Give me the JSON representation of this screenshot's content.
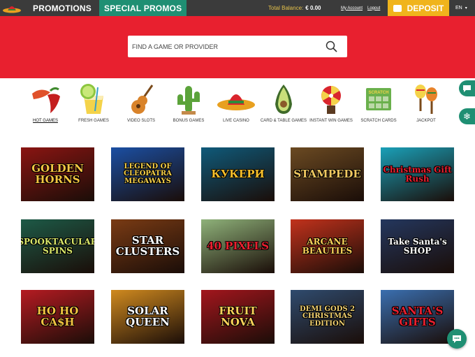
{
  "header": {
    "logo_icon": "sombrero-icon",
    "promotions_label": "PROMOTIONS",
    "special_promos_label": "SPECIAL PROMOS",
    "total_balance_label": "Total Balance:",
    "total_balance_value": "€ 0.00",
    "my_account_label": "My Account",
    "logout_label": "Logout",
    "deposit_label": "DEPOSIT",
    "language": "EN",
    "colors": {
      "topbar": "#3b3b3b",
      "special_promos_bg": "#1f8f73",
      "deposit_bg": "#f0b41c",
      "balance_label": "#e6c24a"
    }
  },
  "hero": {
    "background": "#e8202f",
    "search_placeholder": "FIND A GAME OR PROVIDER"
  },
  "categories": [
    {
      "label": "HOT GAMES",
      "icon": "chili-pepper-icon",
      "active": true
    },
    {
      "label": "FRESH GAMES",
      "icon": "cocktail-icon",
      "active": false
    },
    {
      "label": "VIDEO SLOTS",
      "icon": "guitar-icon",
      "active": false
    },
    {
      "label": "BONUS GAMES",
      "icon": "cactus-icon",
      "active": false
    },
    {
      "label": "LIVE CASINO",
      "icon": "sombrero-icon",
      "active": false
    },
    {
      "label": "CARD & TABLE GAMES",
      "icon": "avocado-icon",
      "active": false
    },
    {
      "label": "INSTANT WIN GAMES",
      "icon": "prize-wheel-icon",
      "active": false
    },
    {
      "label": "SCRATCH CARDS",
      "icon": "scratch-card-icon",
      "active": false
    },
    {
      "label": "JACKPOT",
      "icon": "maracas-icon",
      "active": false
    }
  ],
  "scratch_card_icon_text": "SCRATCH",
  "games": [
    {
      "title": "GOLDEN HORNS",
      "bg": "#8a1512",
      "fg": "#f5c542"
    },
    {
      "title": "LEGEND OF CLEOPATRA MEGAWAYS",
      "bg": "#1b4fa3",
      "fg": "#f7d14a"
    },
    {
      "title": "КУКЕРИ",
      "bg": "#0f5a7a",
      "fg": "#f7c02b"
    },
    {
      "title": "STAMPEDE",
      "bg": "#6b4a22",
      "fg": "#f0c860"
    },
    {
      "title": "Christmas Gift Rush",
      "bg": "#1aa0b8",
      "fg": "#e8202f"
    },
    {
      "title": "SPOOKTACULAR SPINS",
      "bg": "#1d5a47",
      "fg": "#d9e86a"
    },
    {
      "title": "STAR CLUSTERS",
      "bg": "#7a3b14",
      "fg": "#ffffff"
    },
    {
      "title": "40 PIXELS",
      "bg": "#8fb27a",
      "fg": "#e8202f"
    },
    {
      "title": "ARCANE BEAUTIES",
      "bg": "#c2321c",
      "fg": "#ffd25a"
    },
    {
      "title": "Take Santa's SHOP",
      "bg": "#24375e",
      "fg": "#ffffff"
    },
    {
      "title": "HO HO CA$H",
      "bg": "#b51b22",
      "fg": "#f5c542"
    },
    {
      "title": "SOLAR QUEEN",
      "bg": "#d08a1f",
      "fg": "#ffffff"
    },
    {
      "title": "FRUIT NOVA",
      "bg": "#a3161d",
      "fg": "#ffd25a"
    },
    {
      "title": "DEMI GODS 2 CHRISTMAS EDITION",
      "bg": "#2f4b6e",
      "fg": "#f0d070"
    },
    {
      "title": "SANTA'S GIFTS",
      "bg": "#3a6fb0",
      "fg": "#e8202f"
    }
  ]
}
